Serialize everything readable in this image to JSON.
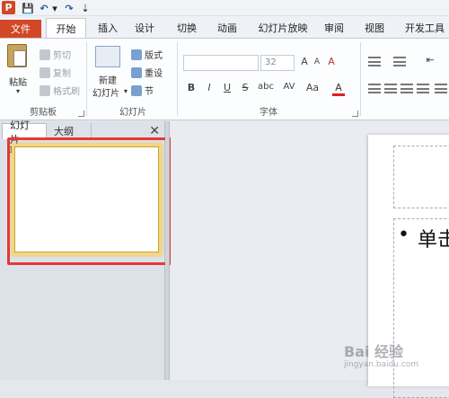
{
  "qat": {
    "app_logo": "P",
    "save": "💾",
    "undo": "↶",
    "undo_dropdown": "▾",
    "redo": "↷",
    "customize": "⇣"
  },
  "tabs": [
    "文件",
    "开始",
    "插入",
    "设计",
    "切换",
    "动画",
    "幻灯片放映",
    "审阅",
    "视图",
    "开发工具"
  ],
  "ribbon": {
    "clipboard": {
      "paste": "粘贴",
      "paste_dropdown": "▾",
      "cut": "剪切",
      "copy": "复制",
      "format_painter": "格式刷",
      "group_label": "剪贴板"
    },
    "slides": {
      "new_slide_line1": "新建",
      "new_slide_line2": "幻灯片",
      "new_slide_dropdown": "▾",
      "layout": "版式",
      "reset": "重设",
      "section": "节",
      "group_label": "幻灯片"
    },
    "font": {
      "font_name": "",
      "font_size": "32",
      "grow": "A",
      "shrink": "A",
      "clear": "A",
      "bold": "B",
      "italic": "I",
      "underline": "U",
      "strike": "S",
      "shadow": "abc",
      "spacing": "AV",
      "case": "Aa",
      "color": "A",
      "group_label": "字体"
    },
    "paragraph": {
      "indent": "⇤"
    }
  },
  "left_panel": {
    "tab_slides": "幻灯片",
    "tab_outline": "大纲",
    "close": "✕",
    "slide_number": "1"
  },
  "slide": {
    "bullet": "•",
    "bullet_text": "单击"
  },
  "watermark": {
    "brand": "Bai 经验",
    "url": "jingyan.baidu.com"
  },
  "colors": {
    "accent": "#d24726",
    "highlight": "#e53935",
    "thumb_border": "#f5d67a"
  }
}
